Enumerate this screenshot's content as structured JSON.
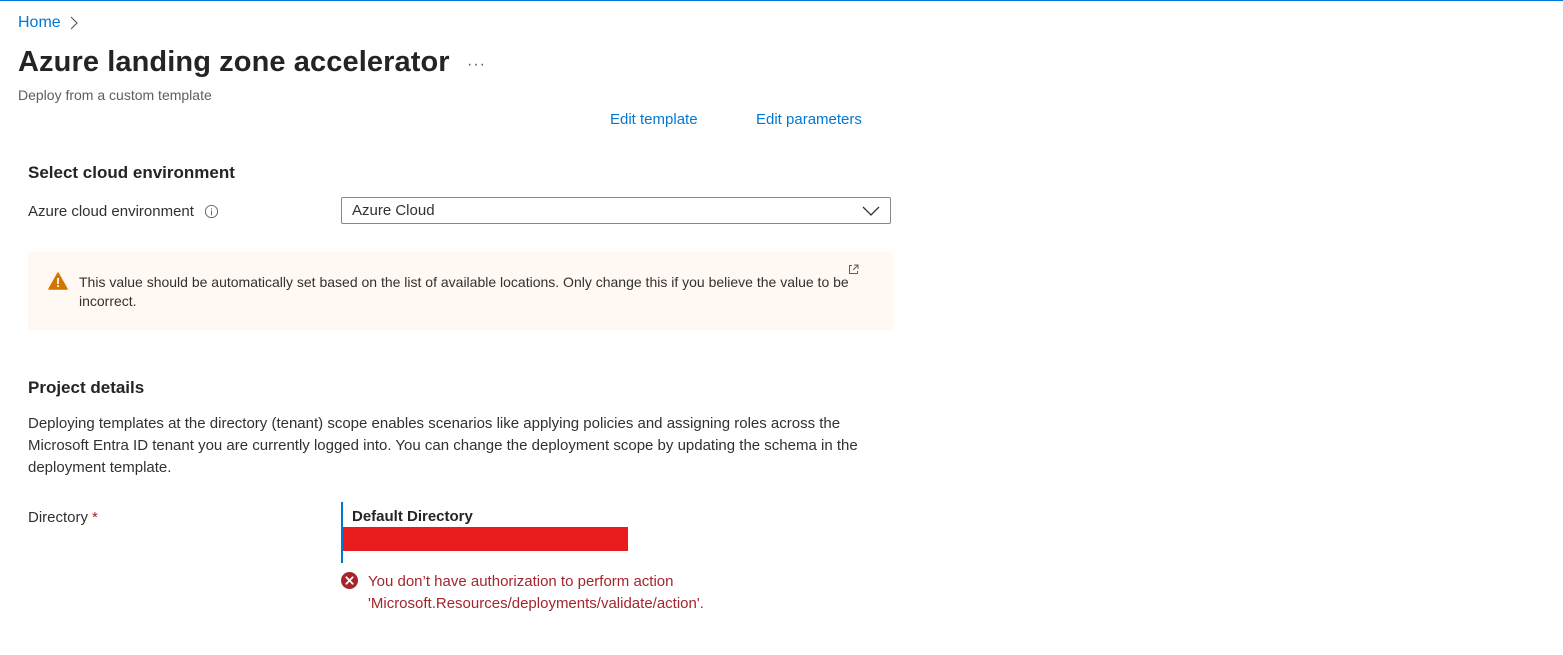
{
  "breadcrumb": {
    "home": "Home"
  },
  "header": {
    "title": "Azure landing zone accelerator",
    "more": "···",
    "subtitle": "Deploy from a custom template"
  },
  "links": {
    "edit_template": "Edit template",
    "edit_parameters": "Edit parameters"
  },
  "cloud_section": {
    "heading": "Select cloud environment",
    "field_label": "Azure cloud environment",
    "selected_value": "Azure Cloud",
    "warning": "This value should be automatically set based on the list of available locations. Only change this if you believe the value to be incorrect."
  },
  "project_section": {
    "heading": "Project details",
    "description": "Deploying templates at the directory (tenant) scope enables scenarios like applying policies and assigning roles across the Microsoft Entra ID tenant you are currently logged into. You can change the deployment scope by updating the schema in the deployment template.",
    "directory_label": "Directory",
    "required_mark": "*",
    "directory_name": "Default Directory",
    "error_message": "You don’t have authorization to perform action 'Microsoft.Resources/deployments/validate/action'."
  },
  "colors": {
    "accent": "#0078d4",
    "warning_bg": "#fff8f3",
    "warning_icon": "#d47500",
    "error": "#a4262c",
    "redaction": "#e81c1c"
  }
}
